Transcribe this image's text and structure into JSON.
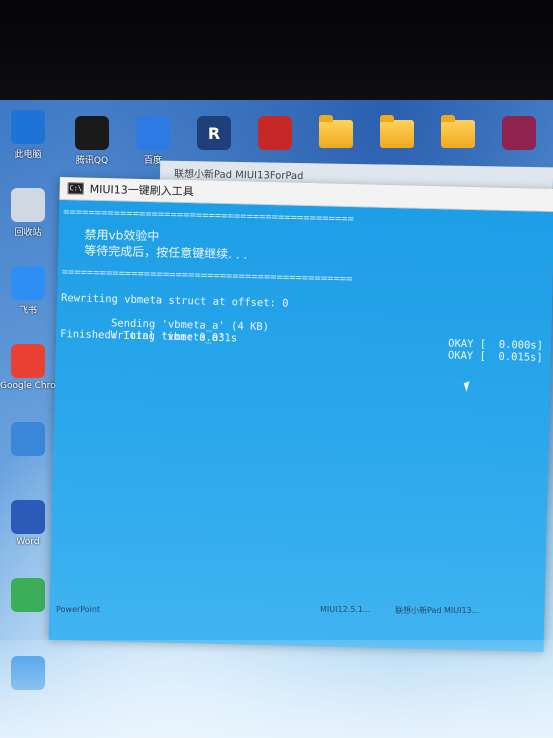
{
  "desktop": {
    "left_icons": [
      {
        "label": "此电脑",
        "icon": "monitor-icon",
        "color": "#1e74d6"
      },
      {
        "label": "回收站",
        "icon": "recycle-bin-icon",
        "color": "#cfd8e3"
      },
      {
        "label": "飞书",
        "icon": "feishu-icon",
        "color": "#2f8ef5"
      },
      {
        "label": "Google Chrome",
        "icon": "chrome-icon",
        "color": "#e94235"
      },
      {
        "label": "",
        "icon": "app-icon",
        "color": "#3a86d8"
      },
      {
        "label": "Word",
        "icon": "word-icon",
        "color": "#2b5bb8"
      },
      {
        "label": "",
        "icon": "app-icon",
        "color": "#3cae5a"
      },
      {
        "label": "",
        "icon": "app-icon",
        "color": "#1e88e5"
      }
    ],
    "top_icons": [
      {
        "label": "腾讯QQ",
        "icon": "qq-icon",
        "color": "#1a1a1a",
        "glyph": ""
      },
      {
        "label": "百度",
        "icon": "baidu-netdisk-icon",
        "color": "#2c7be5",
        "glyph": ""
      },
      {
        "label": "",
        "icon": "revit-icon",
        "color": "#1f3f7a",
        "glyph": "R"
      },
      {
        "label": "",
        "icon": "media-icon",
        "color": "#c62828",
        "glyph": ""
      },
      {
        "label": "",
        "icon": "folder-icon",
        "color": "#f1a81c",
        "glyph": ""
      },
      {
        "label": "",
        "icon": "folder-icon",
        "color": "#f1a81c",
        "glyph": ""
      },
      {
        "label": "",
        "icon": "folder-icon",
        "color": "#f1a81c",
        "glyph": ""
      },
      {
        "label": "",
        "icon": "winrar-icon",
        "color": "#8e244d",
        "glyph": ""
      }
    ],
    "bottom_labels": [
      "PowerPoint",
      "MIUI12.5.1...",
      "联想小新Pad MIUI13..."
    ]
  },
  "background_window": {
    "title": "联想小新Pad MIUI13ForPad"
  },
  "console": {
    "title": "MIUI13一键刷入工具",
    "separator": "==============================================",
    "heading_1": "禁用vb效验中",
    "heading_2": "等待完成后，按任意键继续. . .",
    "log": [
      "Rewriting vbmeta struct at offset: 0",
      "Sending 'vbmeta_a' (4 KB)",
      "Writing 'vbmeta_a'",
      "Finished. Total time: 0.031s"
    ],
    "okay": [
      "OKAY [  0.000s]",
      "OKAY [  0.015s]"
    ]
  }
}
